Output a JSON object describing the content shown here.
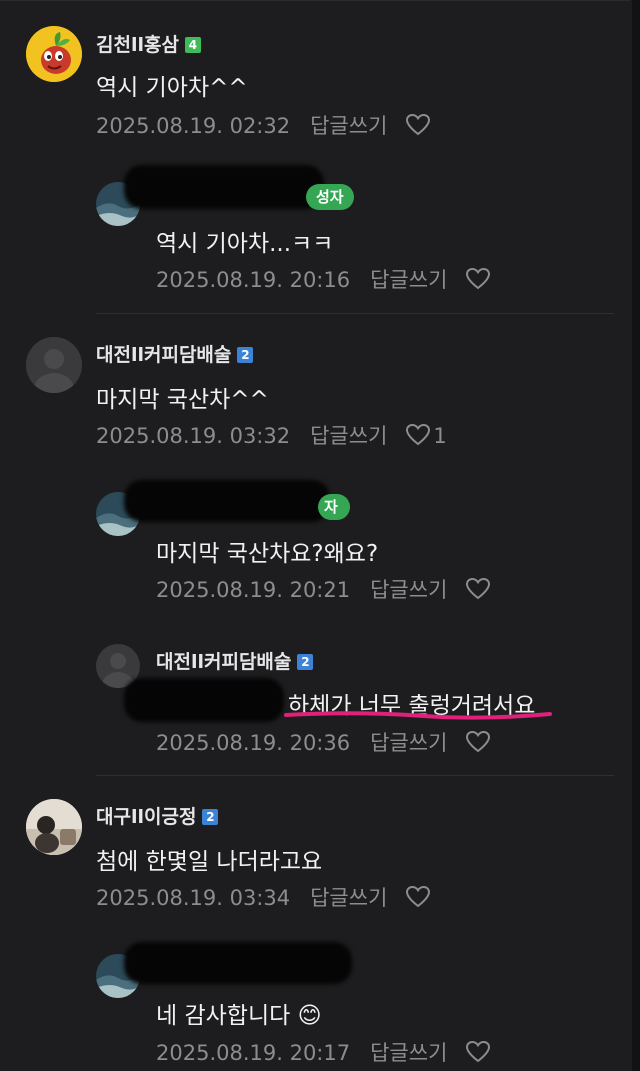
{
  "comments": [
    {
      "author": "김천ll홍삼",
      "level": "4",
      "text": "역시 기아차^^",
      "date": "2025.08.19. 02:32",
      "reply_label": "답글쓰기",
      "likes": ""
    },
    {
      "author": "",
      "badge": "성자",
      "text": "역시 기아차...ㅋㅋ",
      "date": "2025.08.19. 20:16",
      "reply_label": "답글쓰기",
      "likes": ""
    },
    {
      "author": "대전ll커피담배술",
      "level": "2",
      "text": "마지막 국산차^^",
      "date": "2025.08.19. 03:32",
      "reply_label": "답글쓰기",
      "likes": "1"
    },
    {
      "author": "",
      "badge": "자",
      "text": "마지막 국산차요?왜요?",
      "date": "2025.08.19. 20:21",
      "reply_label": "답글쓰기",
      "likes": ""
    },
    {
      "author": "대전ll커피담배술",
      "level": "2",
      "text": "하체가 너무 출렁거려서요",
      "date": "2025.08.19. 20:36",
      "reply_label": "답글쓰기",
      "likes": ""
    },
    {
      "author": "대구ll이긍정",
      "level": "2",
      "text": "첨에 한몇일 나더라고요",
      "date": "2025.08.19. 03:34",
      "reply_label": "답글쓰기",
      "likes": ""
    },
    {
      "author": "",
      "badge": "",
      "text": "네 감사합니다 😊",
      "date": "2025.08.19. 20:17",
      "reply_label": "답글쓰기",
      "likes": ""
    }
  ],
  "colors": {
    "background": "#1d1d1f",
    "author_badge": "#35a653",
    "level_green": "#3fbb5a",
    "level_blue": "#3c83d8",
    "highlight_underline": "#e0207a",
    "meta_text": "#8d8d8f"
  },
  "icons": {
    "like": "heart-outline-icon"
  }
}
